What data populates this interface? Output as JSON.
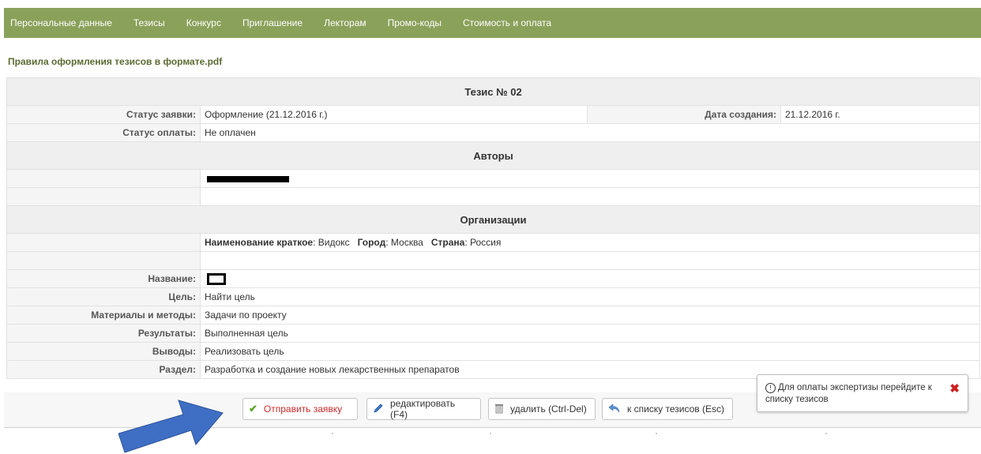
{
  "nav": {
    "items": [
      "Персональные данные",
      "Тезисы",
      "Конкурс",
      "Приглашение",
      "Лекторам",
      "Промо-коды",
      "Стоимость и оплата"
    ]
  },
  "pdf_link": "Правила оформления тезисов в формате.pdf",
  "thesis": {
    "header": "Тезис № 02",
    "status_label": "Статус заявки:",
    "status_value": "Оформление (21.12.2016 г.)",
    "created_label": "Дата создания:",
    "created_value": "21.12.2016 г.",
    "payment_label": "Статус оплаты:",
    "payment_value": "Не оплачен"
  },
  "authors": {
    "header": "Авторы"
  },
  "organizations": {
    "header": "Организации",
    "short_name_label": "Наименование краткое",
    "short_name_value": ": Видокс",
    "city_label": "Город",
    "city_value": ": Москва",
    "country_label": "Страна",
    "country_value": ": Россия"
  },
  "details": [
    {
      "label": "Название:",
      "value": ""
    },
    {
      "label": "Цель:",
      "value": "Найти цель"
    },
    {
      "label": "Материалы и методы:",
      "value": "Задачи по проекту"
    },
    {
      "label": "Результаты:",
      "value": "Выполненная цель"
    },
    {
      "label": "Выводы:",
      "value": "Реализовать цель"
    },
    {
      "label": "Раздел:",
      "value": "Разработка и создание новых лекарственных препаратов"
    }
  ],
  "actions": {
    "send": "Отправить заявку",
    "edit": "редактировать (F4)",
    "delete": "удалить (Ctrl-Del)",
    "back": "к списку тезисов (Esc)"
  },
  "toast": {
    "text": "Для оплаты экспертизы перейдите к списку тезисов"
  },
  "colors": {
    "nav_bg": "#8aa15a",
    "send_text": "#cc2b2b",
    "arrow": "#3f6fc4"
  }
}
